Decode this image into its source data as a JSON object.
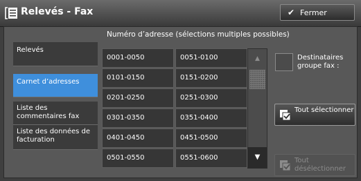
{
  "window": {
    "title": "Relevés - Fax",
    "close_label": "Fermer"
  },
  "heading": "Numéro d’adresse (sélections multiples possibles)",
  "sidebar": {
    "items": [
      {
        "label": "Relevés"
      },
      {
        "label": "Carnet d’adresses",
        "active": true
      },
      {
        "label": "Liste des commentaires fax"
      },
      {
        "label": "Liste des données de facturation"
      }
    ]
  },
  "address_ranges": [
    [
      "0001-0050",
      "0051-0100"
    ],
    [
      "0101-0150",
      "0151-0200"
    ],
    [
      "0201-0250",
      "0251-0300"
    ],
    [
      "0301-0350",
      "0351-0400"
    ],
    [
      "0401-0450",
      "0451-0500"
    ],
    [
      "0501-0550",
      "0551-0600"
    ]
  ],
  "group_recipients": {
    "label": "Destinataires groupe fax :",
    "checked": false
  },
  "buttons": {
    "select_all": "Tout sélectionner",
    "deselect_all": "Tout désélectionner",
    "deselect_all_enabled": false
  },
  "icons": {
    "title": "fax-list-icon",
    "close": "checkmark-icon",
    "scroll_up": "arrow-up-icon",
    "scroll_down": "arrow-down-icon",
    "select_all": "select-all-icon",
    "deselect_all": "deselect-all-icon"
  },
  "colors": {
    "accent": "#3f8fdc"
  }
}
